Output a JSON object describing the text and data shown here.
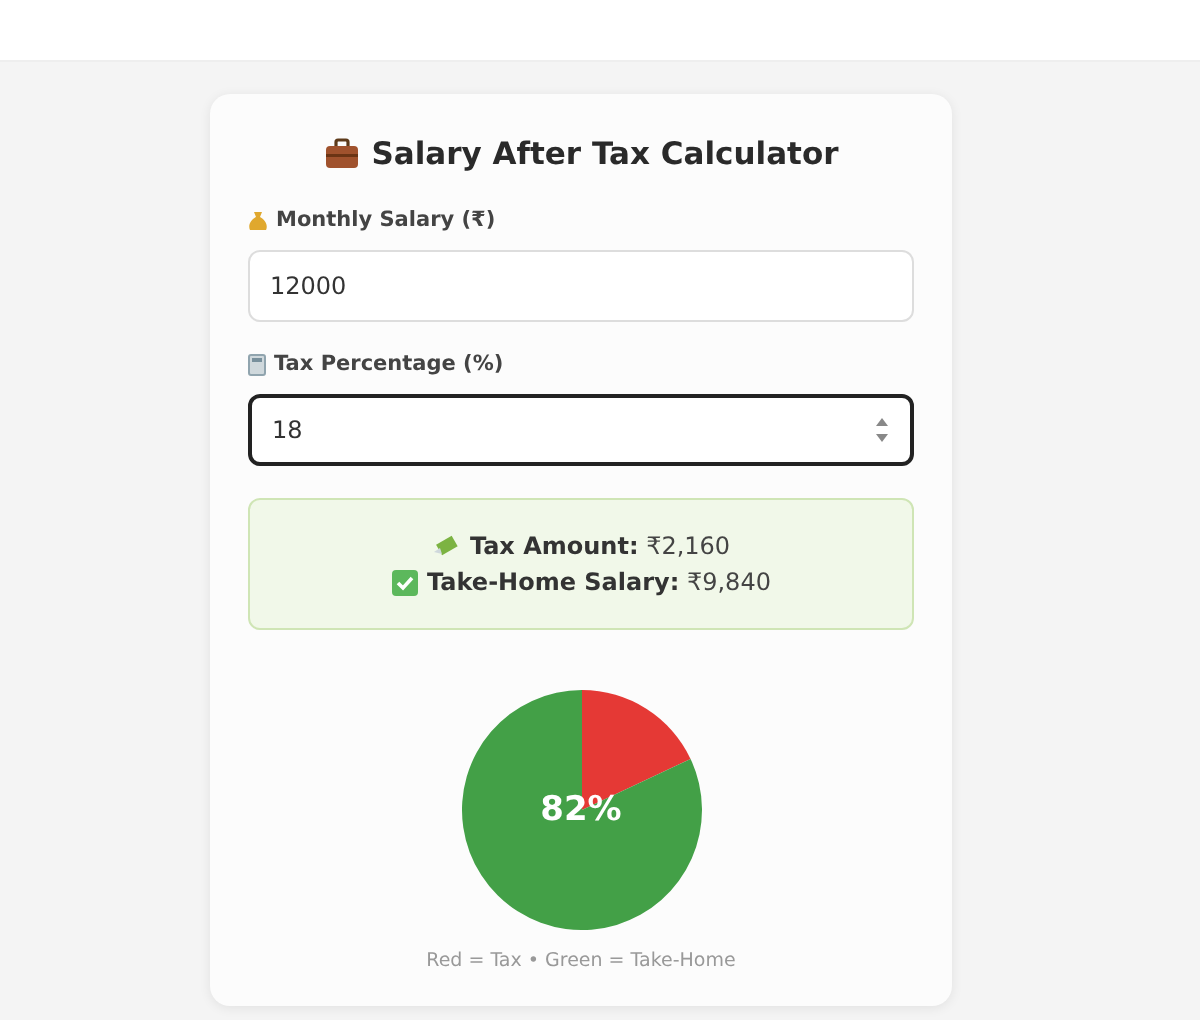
{
  "title": "Salary After Tax Calculator",
  "fields": [
    {
      "label": "Monthly Salary (₹)",
      "value": "12000",
      "focused": false,
      "kind": "text"
    },
    {
      "label": "Tax Percentage (%)",
      "value": "18",
      "focused": true,
      "kind": "number"
    }
  ],
  "result": [
    {
      "label": "Tax Amount:",
      "value": "₹2,160",
      "kind": "tax"
    },
    {
      "label": "Take-Home Salary:",
      "value": "₹9,840",
      "kind": "home"
    }
  ],
  "chart": {
    "chart_data": {
      "type": "pie",
      "values": [
        18,
        82
      ]
    },
    "center_label": "82%",
    "legend": "Red = Tax • Green = Take-Home"
  }
}
